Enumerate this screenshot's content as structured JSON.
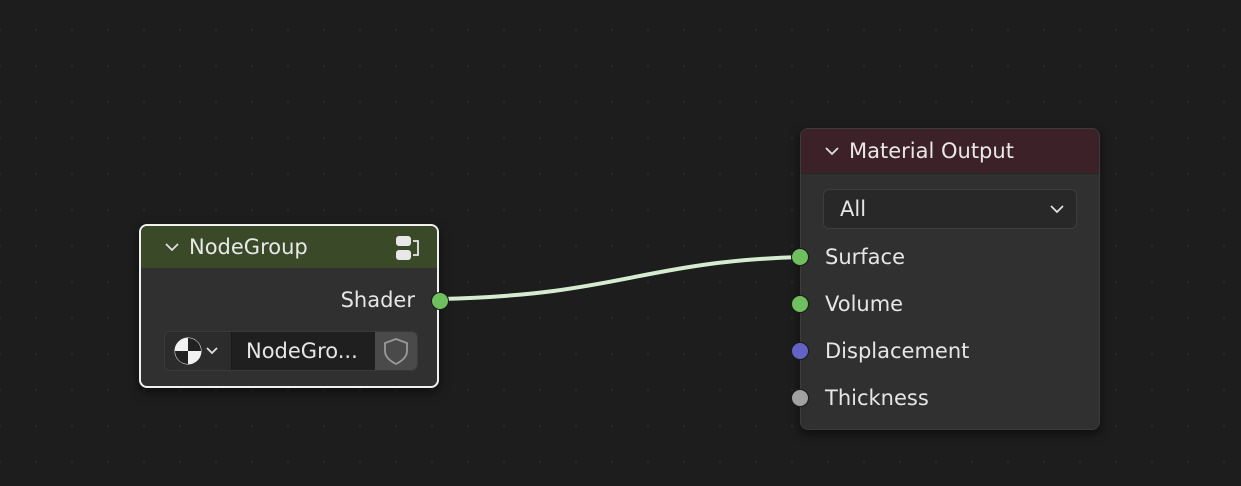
{
  "nodes": {
    "node_group": {
      "title": "NodeGroup",
      "header_color": "#3a4a28",
      "output_label": "Shader",
      "output_socket_color": "#6fbf5f",
      "datablock_name": "NodeGro...",
      "icons": [
        "chevron-down-icon",
        "node-tree-icon",
        "material-type-icon",
        "fake-user-shield-icon"
      ]
    },
    "material_output": {
      "title": "Material Output",
      "header_color": "#3c2128",
      "target_value": "All",
      "inputs": [
        {
          "label": "Surface",
          "socket_color": "#6fbf5f"
        },
        {
          "label": "Volume",
          "socket_color": "#6fbf5f"
        },
        {
          "label": "Displacement",
          "socket_color": "#6363c7"
        },
        {
          "label": "Thickness",
          "socket_color": "#a1a1a1"
        }
      ]
    }
  },
  "link": {
    "from": "NodeGroup.Shader",
    "to": "Material Output.Surface",
    "color": "#d6ecd0"
  }
}
